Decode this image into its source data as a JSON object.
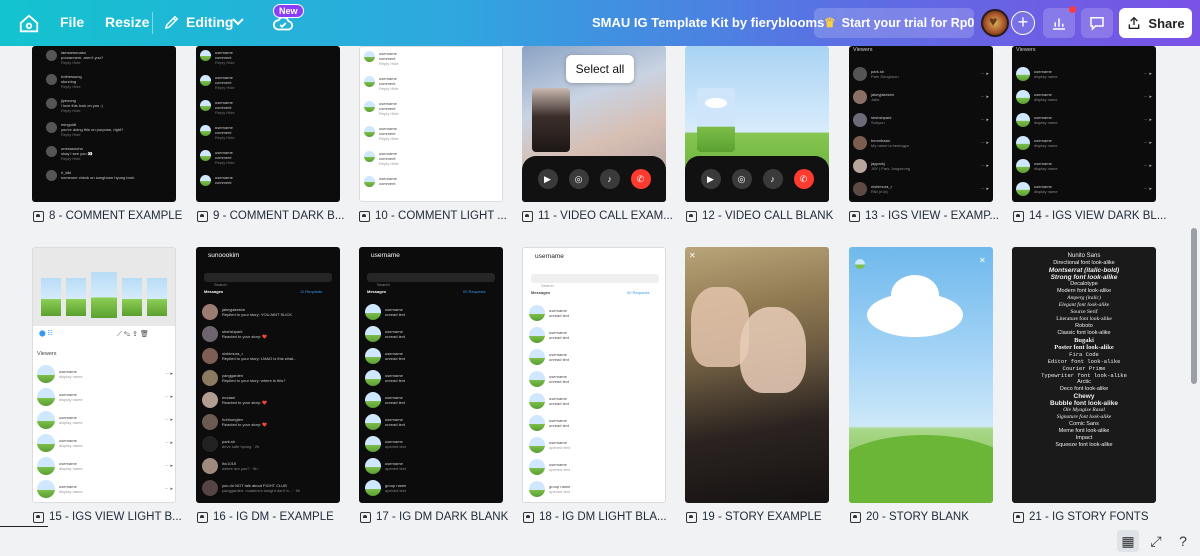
{
  "topbar": {
    "file_label": "File",
    "resize_label": "Resize",
    "editing_label": "Editing",
    "new_badge": "New",
    "doc_title": "SMAU IG Template Kit by fieryblooms",
    "trial_label": "Start your trial for Rp0",
    "share_label": "Share"
  },
  "pages": [
    {
      "caption": "8 - COMMENT EXAMPLE"
    },
    {
      "caption": "9 - COMMENT DARK B..."
    },
    {
      "caption": "10 - COMMENT LIGHT ..."
    },
    {
      "caption": "11 - VIDEO CALL EXAM..."
    },
    {
      "caption": "12 - VIDEO CALL BLANK"
    },
    {
      "caption": "13 - IGS VIEW - EXAMP..."
    },
    {
      "caption": "14 - IGS VIEW DARK BL..."
    },
    {
      "caption": "15 - IGS VIEW LIGHT B..."
    },
    {
      "caption": "16 - IG DM - EXAMPLE"
    },
    {
      "caption": "17 - IG DM DARK BLANK"
    },
    {
      "caption": "18 - IG DM LIGHT BLA..."
    },
    {
      "caption": "19 - STORY EXAMPLE"
    },
    {
      "caption": "20 - STORY BLANK"
    },
    {
      "caption": "21 - IG STORY FONTS"
    }
  ],
  "overlay": {
    "select_all": "Select all"
  },
  "thumbs": {
    "comment_example": [
      {
        "user": "iamsamunaso",
        "text": "poorannem, aren't you?"
      },
      {
        "user": "hothessung",
        "text": "stunning"
      },
      {
        "user": "jiyeoong",
        "text": "i love this look on you :)"
      },
      {
        "user": "minguidt",
        "text": "you're doing this on purpose, right?"
      },
      {
        "user": "onesasoohn",
        "text": "okay i see you 👀"
      },
      {
        "user": "ri_kiki",
        "text": "someone check on sunghoon hyung bruh"
      }
    ],
    "comment_blank": [
      {
        "user": "username",
        "text": "comment"
      },
      {
        "user": "username",
        "text": "comment"
      },
      {
        "user": "username",
        "text": "comment"
      },
      {
        "user": "username",
        "text": "comment"
      },
      {
        "user": "username",
        "text": "comment"
      },
      {
        "user": "username",
        "text": "comment"
      }
    ],
    "reply_hide": "Reply   Hide",
    "viewers_label": "Viewers",
    "views_example": [
      {
        "user": "park.sh",
        "name": "Park Sunghoon"
      },
      {
        "user": "jakeyjakesim",
        "name": "Jake"
      },
      {
        "user": "shshshpark",
        "name": "Sohyun"
      },
      {
        "user": "beombasic",
        "name": "My name is beomgyu"
      },
      {
        "user": "jayparkj",
        "name": "JAY | Park Jongseong"
      },
      {
        "user": "nishimura_r",
        "name": "Riki (ri.ki)"
      }
    ],
    "views_blank": [
      {
        "user": "username",
        "name": "display name"
      },
      {
        "user": "username",
        "name": "display name"
      },
      {
        "user": "username",
        "name": "display name"
      },
      {
        "user": "username",
        "name": "display name"
      },
      {
        "user": "username",
        "name": "display name"
      },
      {
        "user": "username",
        "name": "display name"
      }
    ],
    "dm_example_user": "sunoookim",
    "dm_blank_user": "username",
    "search_placeholder": "Search",
    "messages_label": "Messages",
    "requests_example": "11 Requests",
    "requests_blank": "00 Requests",
    "dm_example": [
      {
        "user": "jakeyjakesim",
        "text": "Replied to your story: YOU AINT SLICK"
      },
      {
        "user": "shshshpark",
        "text": "Reacted to your story: ❤️"
      },
      {
        "user": "nishimura_r",
        "text": "Replied to your story: LMAO is this what..."
      },
      {
        "user": "yanggarden",
        "text": "Replied to your story: where is this?"
      },
      {
        "user": "modani",
        "text": "Reacted to your story: ❤️"
      },
      {
        "user": "huhhunglen",
        "text": "Reacted to your story: ❤️"
      },
      {
        "user": "park.sh",
        "text": "drive safe hyung · 2h"
      },
      {
        "user": "lhc1015",
        "text": "where are you? · 5h"
      },
      {
        "user": "you do NOT talk about FIGHT CLUB",
        "text": "yanggarden: nudaem's tonight don't b... · 5h"
      }
    ],
    "dm_blank": [
      {
        "user": "username",
        "text": "unread text"
      },
      {
        "user": "username",
        "text": "unread text"
      },
      {
        "user": "username",
        "text": "unread text"
      },
      {
        "user": "username",
        "text": "unread text"
      },
      {
        "user": "username",
        "text": "unread text"
      },
      {
        "user": "username",
        "text": "unread text"
      },
      {
        "user": "username",
        "text": "opened text"
      },
      {
        "user": "username",
        "text": "opened text"
      },
      {
        "user": "group name",
        "text": "opened text"
      }
    ],
    "fonts": [
      {
        "name": "Nunito Sans",
        "desc": "Directional font look-alike"
      },
      {
        "name": "Montserrat (italic-bold)",
        "desc": "Strong font look-alike"
      },
      {
        "name": "Decalotype",
        "desc": "Modern font look-alike"
      },
      {
        "name": "Amperg (italic)",
        "desc": "Elegant font look-alike"
      },
      {
        "name": "Source Serif",
        "desc": "Literature font look-alike"
      },
      {
        "name": "Roboto",
        "desc": "Classic font look-alike"
      },
      {
        "name": "Bugaki",
        "desc": "Poster font look-alike"
      },
      {
        "name": "Fira Code",
        "desc": "Editor font look-alike"
      },
      {
        "name": "Courier Prime",
        "desc": "Typewriter font look-alike"
      },
      {
        "name": "Arctic",
        "desc": "Deco font look-alike"
      },
      {
        "name": "Chewy",
        "desc": "Bubble font look-alike"
      },
      {
        "name": "Ole Myagise Rasal",
        "desc": "Signature font look-alike"
      },
      {
        "name": "Comic Sans",
        "desc": "Meme font look-alike"
      },
      {
        "name": "Impact",
        "desc": "Squeeze font look-alike"
      }
    ]
  },
  "colors": {
    "accent_start": "#13c3cf",
    "accent_end": "#7a52e6",
    "end_call": "#ff3b30",
    "requests_link": "#3897f0"
  }
}
